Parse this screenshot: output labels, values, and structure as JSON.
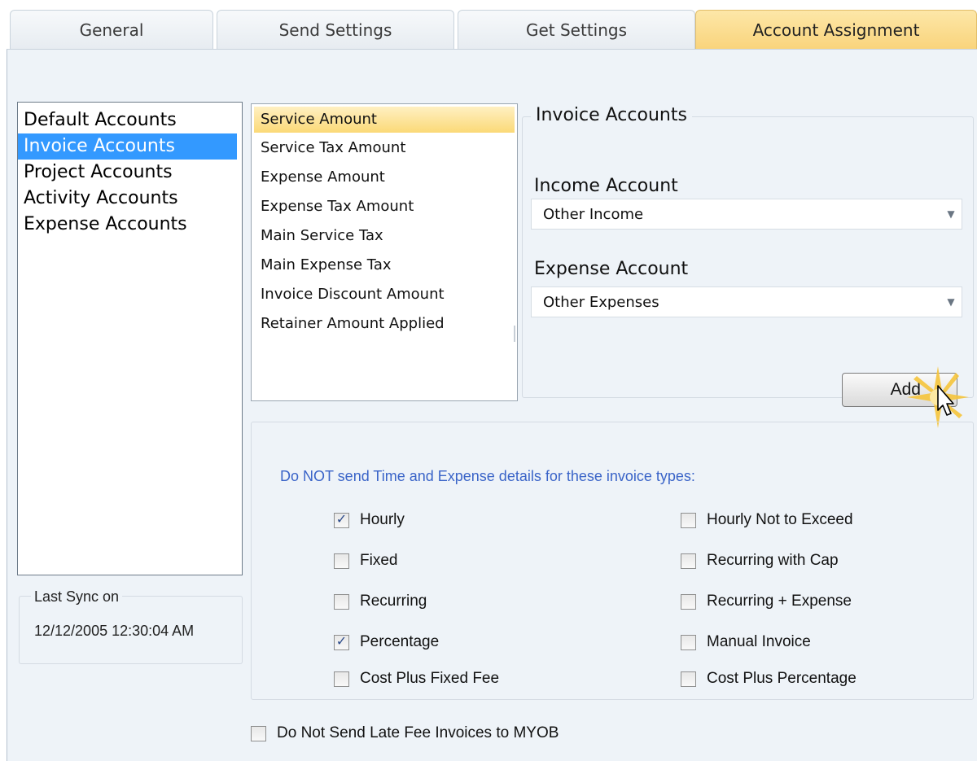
{
  "tabs": [
    {
      "label": "General"
    },
    {
      "label": "Send Settings"
    },
    {
      "label": "Get Settings"
    },
    {
      "label": "Account Assignment",
      "active": true
    }
  ],
  "account_categories": {
    "items": [
      {
        "label": "Default Accounts"
      },
      {
        "label": "Invoice Accounts",
        "selected": true
      },
      {
        "label": "Project Accounts"
      },
      {
        "label": "Activity Accounts"
      },
      {
        "label": "Expense Accounts"
      }
    ]
  },
  "sync": {
    "label": "Last Sync on",
    "value": "12/12/2005 12:30:04 AM"
  },
  "amount_list": {
    "items": [
      {
        "label": "Service Amount",
        "selected": true
      },
      {
        "label": "Service Tax Amount"
      },
      {
        "label": "Expense Amount"
      },
      {
        "label": "Expense Tax Amount"
      },
      {
        "label": "Main Service Tax"
      },
      {
        "label": "Main Expense Tax"
      },
      {
        "label": "Invoice Discount Amount"
      },
      {
        "label": "Retainer Amount Applied"
      }
    ]
  },
  "invoice_accounts": {
    "title": "Invoice Accounts",
    "income_label": "Income Account",
    "income_value": "Other Income",
    "expense_label": "Expense Account",
    "expense_value": "Other Expenses",
    "add_label": "Add"
  },
  "invoice_types": {
    "heading": "Do NOT send Time and Expense details for these invoice types:",
    "left": [
      {
        "label": "Hourly",
        "checked": true
      },
      {
        "label": "Fixed",
        "checked": false
      },
      {
        "label": "Recurring",
        "checked": false
      },
      {
        "label": "Percentage",
        "checked": true
      },
      {
        "label": "Cost Plus Fixed Fee",
        "checked": false
      }
    ],
    "right": [
      {
        "label": "Hourly Not to Exceed",
        "checked": false
      },
      {
        "label": "Recurring with Cap",
        "checked": false
      },
      {
        "label": "Recurring + Expense",
        "checked": false
      },
      {
        "label": "Manual Invoice",
        "checked": false
      },
      {
        "label": "Cost Plus Percentage",
        "checked": false
      }
    ]
  },
  "late_fee": {
    "label": "Do Not Send Late Fee Invoices to MYOB",
    "checked": false
  },
  "colors": {
    "active_tab": "#f9d47c",
    "selection_blue": "#3399ff",
    "heading_blue": "#3a64c8",
    "panel_bg": "#eef3f8"
  }
}
